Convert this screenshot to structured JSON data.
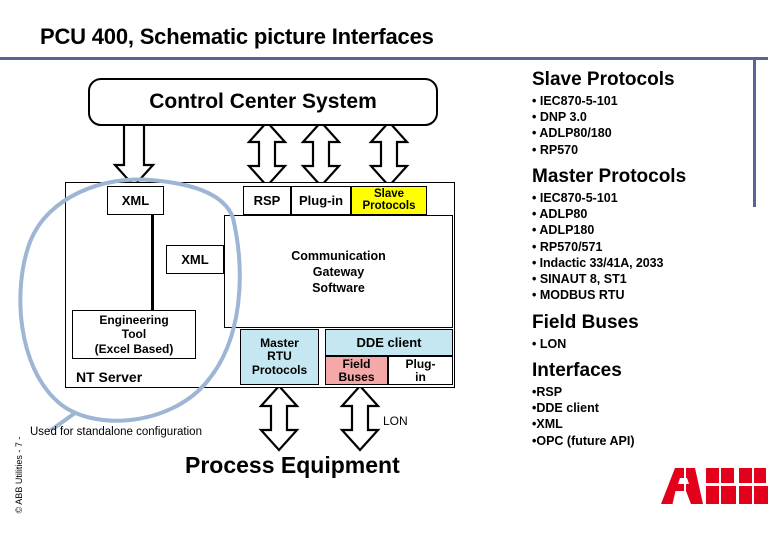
{
  "slide": {
    "title": "PCU 400, Schematic picture Interfaces",
    "footer": "© ABB Utilities  - 7 -",
    "logo_text": "ABB",
    "accent_rule_color": "#5b6391",
    "logo_color": "#e2001a"
  },
  "diagram": {
    "control_center": "Control Center System",
    "top_row": [
      {
        "label": "XML",
        "fill": "#ffffff"
      },
      {
        "label": "RSP",
        "fill": "#ffffff"
      },
      {
        "label": "Plug-in",
        "fill": "#ffffff"
      },
      {
        "label": "Slave\nProtocols",
        "label_line1": "Slave",
        "label_line2": "Protocols",
        "fill": "#ffff00"
      }
    ],
    "xml_mid": "XML",
    "engineering_tool": {
      "line1": "Engineering",
      "line2": "Tool",
      "line3": "(Excel Based)"
    },
    "nt_server": "NT Server",
    "gateway_software": {
      "line1": "Communication",
      "line2": "Gateway",
      "line3": "Software"
    },
    "bottom_row": {
      "master_rtu": {
        "line1": "Master",
        "line2": "RTU",
        "line3": "Protocols",
        "fill": "#c4e7f2"
      },
      "dde_client": {
        "label": "DDE client",
        "fill": "#c4e7f2"
      },
      "field_buses": {
        "line1": "Field",
        "line2": "Buses",
        "fill": "#f4a8a8"
      },
      "plugin": {
        "line1": "Plug-",
        "line2": "in",
        "fill": "#ffffff"
      }
    },
    "standalone_note": "Used for standalone configuration",
    "lon_label": "LON",
    "process_equipment": "Process Equipment",
    "ellipse_color": "#9fb5d4"
  },
  "protocols": {
    "slave": {
      "heading": "Slave Protocols",
      "items": [
        "• IEC870-5-101",
        "• DNP 3.0",
        "• ADLP80/180",
        "• RP570"
      ]
    },
    "master": {
      "heading": "Master Protocols",
      "items": [
        "• IEC870-5-101",
        "• ADLP80",
        "• ADLP180",
        "• RP570/571",
        "• Indactic 33/41A, 2033",
        "• SINAUT 8, ST1",
        "• MODBUS RTU"
      ]
    },
    "field_buses": {
      "heading": "Field Buses",
      "items": [
        "• LON"
      ]
    },
    "interfaces": {
      "heading": "Interfaces",
      "items": [
        "•RSP",
        "•DDE client",
        "•XML",
        "•OPC (future API)"
      ]
    }
  }
}
